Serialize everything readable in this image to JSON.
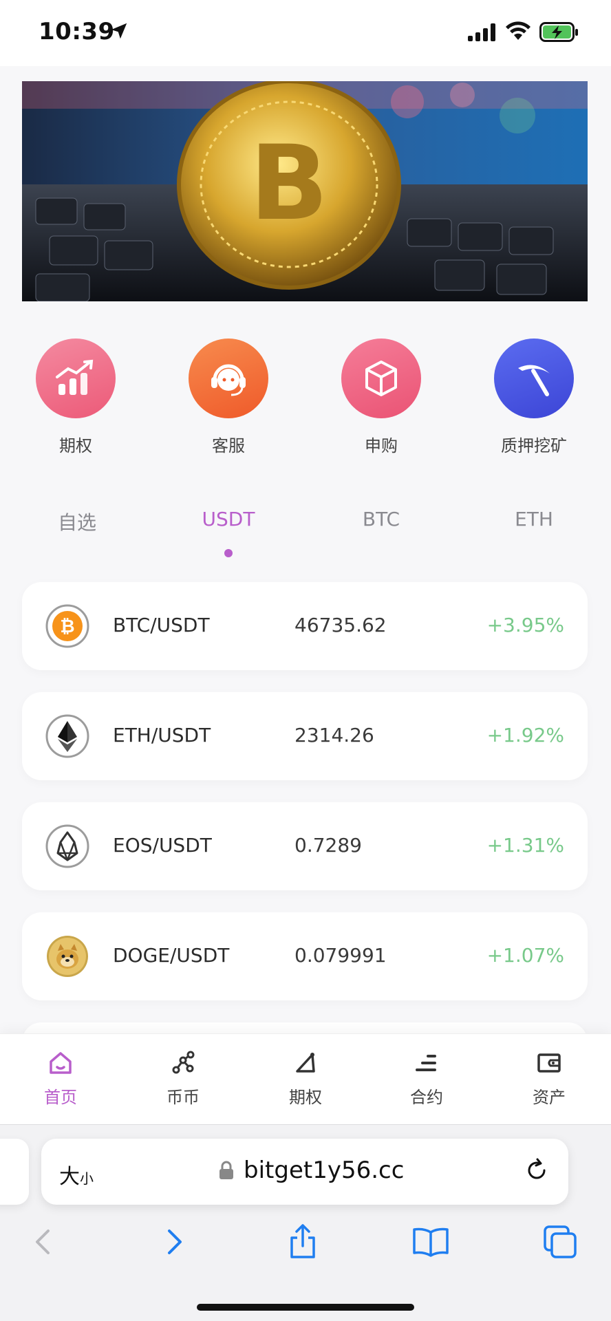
{
  "status_bar": {
    "time": "10:39",
    "icons": [
      "location-arrow-icon",
      "cellular-signal-icon",
      "wifi-icon",
      "battery-charging-icon"
    ]
  },
  "banner": {
    "image": "bitcoin-coin-on-keyboard"
  },
  "quick_menu": [
    {
      "label": "期权",
      "icon": "chart-up-icon",
      "color": "#f06a86"
    },
    {
      "label": "客服",
      "icon": "headset-icon",
      "color": "#f36b3b"
    },
    {
      "label": "申购",
      "icon": "box-icon",
      "color": "#ef5f7f"
    },
    {
      "label": "质押挖矿",
      "icon": "pickaxe-icon",
      "color": "#4e58e2"
    }
  ],
  "market_tabs": {
    "items": [
      "自选",
      "USDT",
      "BTC",
      "ETH"
    ],
    "active": "USDT"
  },
  "market_list": [
    {
      "pair": "BTC/USDT",
      "price": "46735.62",
      "change": "+3.95%",
      "logo": "btc-logo-icon"
    },
    {
      "pair": "ETH/USDT",
      "price": "2314.26",
      "change": "+1.92%",
      "logo": "eth-logo-icon"
    },
    {
      "pair": "EOS/USDT",
      "price": "0.7289",
      "change": "+1.31%",
      "logo": "eos-logo-icon"
    },
    {
      "pair": "DOGE/USDT",
      "price": "0.079991",
      "change": "+1.07%",
      "logo": "doge-logo-icon"
    }
  ],
  "bottom_nav": [
    {
      "label": "首页",
      "icon": "home-icon",
      "active": true
    },
    {
      "label": "币币",
      "icon": "exchange-nodes-icon",
      "active": false
    },
    {
      "label": "期权",
      "icon": "options-triangle-icon",
      "active": false
    },
    {
      "label": "合约",
      "icon": "contract-lines-icon",
      "active": false
    },
    {
      "label": "资产",
      "icon": "wallet-icon",
      "active": false
    }
  ],
  "browser": {
    "size_label_big": "大",
    "size_label_small": "小",
    "url": "bitget1y56.cc",
    "tools": [
      "back-icon",
      "forward-icon",
      "share-icon",
      "bookmarks-icon",
      "tabs-icon"
    ]
  },
  "colors": {
    "accent": "#b85ecb",
    "positive": "#78c98a"
  }
}
